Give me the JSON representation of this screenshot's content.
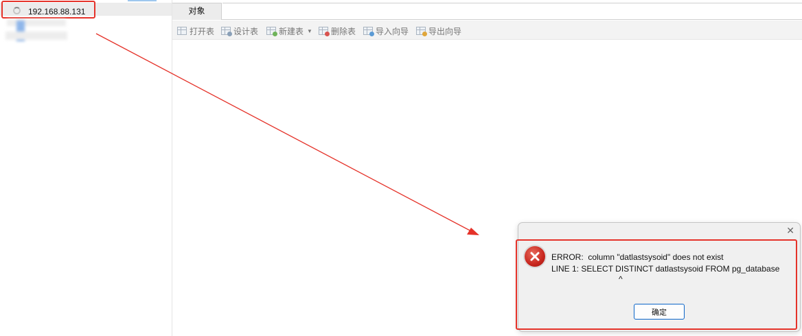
{
  "sidebar": {
    "connection_label": "192.168.88.131"
  },
  "tabs": [
    {
      "label": "对象"
    }
  ],
  "toolbar": {
    "items": [
      {
        "label": "打开表",
        "icon": "table-open-icon"
      },
      {
        "label": "设计表",
        "icon": "table-design-icon"
      },
      {
        "label": "新建表",
        "icon": "table-new-icon",
        "has_dropdown": true
      },
      {
        "label": "删除表",
        "icon": "table-delete-icon"
      },
      {
        "label": "导入向导",
        "icon": "import-wizard-icon"
      },
      {
        "label": "导出向导",
        "icon": "export-wizard-icon"
      }
    ]
  },
  "dialog": {
    "close_glyph": "✕",
    "message_lines": [
      "ERROR:  column \"datlastsysoid\" does not exist",
      "LINE 1: SELECT DISTINCT datlastsysoid FROM pg_database",
      "^"
    ],
    "ok_label": "确定",
    "icon": "error-icon"
  },
  "colors": {
    "annotation_red": "#e53229",
    "error_red": "#c8261e",
    "button_border": "#0a64c8"
  }
}
